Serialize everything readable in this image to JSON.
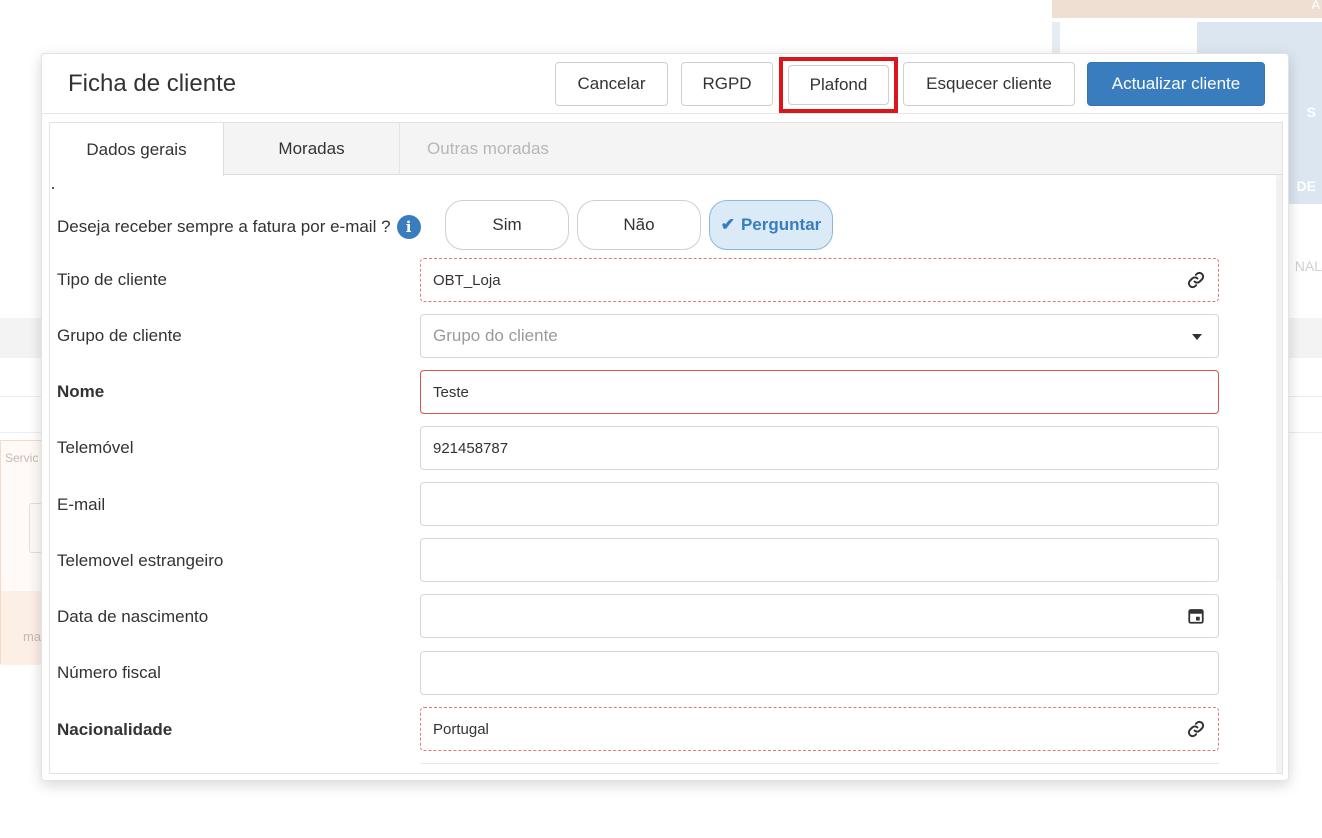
{
  "background": {
    "corner_glyph": "A",
    "blue_panel_text_1": "S",
    "blue_panel_text_2": "DE",
    "side_text": "NAL",
    "card_label": "Servic",
    "card_label_2": "ma"
  },
  "modal": {
    "title": "Ficha de cliente",
    "buttons": {
      "cancel": "Cancelar",
      "rgpd": "RGPD",
      "plafond": "Plafond",
      "forget": "Esquecer cliente",
      "update": "Actualizar cliente"
    },
    "tabs": [
      {
        "label": "Dados gerais",
        "active": true
      },
      {
        "label": "Moradas",
        "active": false
      },
      {
        "label": "Outras moradas",
        "disabled": true
      }
    ],
    "email_invoice": {
      "question": "Deseja receber sempre a fatura por e-mail ?",
      "options": [
        "Sim",
        "Não",
        "Perguntar"
      ],
      "selected": "Perguntar"
    },
    "fields": {
      "client_type": {
        "label": "Tipo de cliente",
        "value": "OBT_Loja"
      },
      "client_group": {
        "label": "Grupo de cliente",
        "placeholder": "Grupo do cliente"
      },
      "name": {
        "label": "Nome",
        "value": "Teste"
      },
      "mobile": {
        "label": "Telemóvel",
        "value": "921458787"
      },
      "email": {
        "label": "E-mail",
        "value": ""
      },
      "foreign_mobile": {
        "label": "Telemovel estrangeiro",
        "value": ""
      },
      "birth_date": {
        "label": "Data de nascimento",
        "value": ""
      },
      "tax_number": {
        "label": "Número fiscal",
        "value": ""
      },
      "nationality": {
        "label": "Nacionalidade",
        "value": "Portugal"
      }
    }
  },
  "colors": {
    "primary": "#3a7dbf",
    "highlight_red": "#d9161c",
    "error_border": "#d9534f",
    "dashed_border": "#e07a7a"
  }
}
